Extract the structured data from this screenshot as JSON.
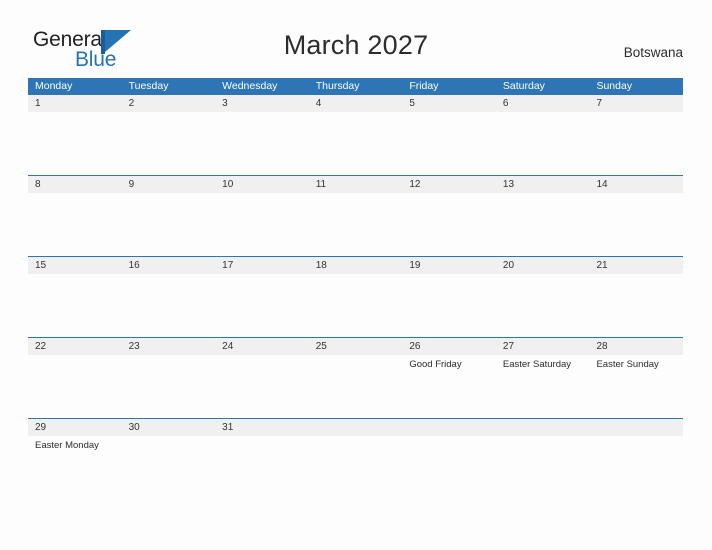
{
  "brand": {
    "name_top": "General",
    "name_bottom": "Blue",
    "accent_color": "#2474b5",
    "logo_mark": "triangle-flag"
  },
  "header": {
    "title": "March 2027",
    "country": "Botswana",
    "header_color": "#2e75b6",
    "band_color": "#f0f0f0"
  },
  "weekdays": [
    "Monday",
    "Tuesday",
    "Wednesday",
    "Thursday",
    "Friday",
    "Saturday",
    "Sunday"
  ],
  "weeks": [
    [
      {
        "day": "1",
        "holiday": ""
      },
      {
        "day": "2",
        "holiday": ""
      },
      {
        "day": "3",
        "holiday": ""
      },
      {
        "day": "4",
        "holiday": ""
      },
      {
        "day": "5",
        "holiday": ""
      },
      {
        "day": "6",
        "holiday": ""
      },
      {
        "day": "7",
        "holiday": ""
      }
    ],
    [
      {
        "day": "8",
        "holiday": ""
      },
      {
        "day": "9",
        "holiday": ""
      },
      {
        "day": "10",
        "holiday": ""
      },
      {
        "day": "11",
        "holiday": ""
      },
      {
        "day": "12",
        "holiday": ""
      },
      {
        "day": "13",
        "holiday": ""
      },
      {
        "day": "14",
        "holiday": ""
      }
    ],
    [
      {
        "day": "15",
        "holiday": ""
      },
      {
        "day": "16",
        "holiday": ""
      },
      {
        "day": "17",
        "holiday": ""
      },
      {
        "day": "18",
        "holiday": ""
      },
      {
        "day": "19",
        "holiday": ""
      },
      {
        "day": "20",
        "holiday": ""
      },
      {
        "day": "21",
        "holiday": ""
      }
    ],
    [
      {
        "day": "22",
        "holiday": ""
      },
      {
        "day": "23",
        "holiday": ""
      },
      {
        "day": "24",
        "holiday": ""
      },
      {
        "day": "25",
        "holiday": ""
      },
      {
        "day": "26",
        "holiday": "Good Friday"
      },
      {
        "day": "27",
        "holiday": "Easter Saturday"
      },
      {
        "day": "28",
        "holiday": "Easter Sunday"
      }
    ],
    [
      {
        "day": "29",
        "holiday": "Easter Monday"
      },
      {
        "day": "30",
        "holiday": ""
      },
      {
        "day": "31",
        "holiday": ""
      },
      {
        "day": "",
        "holiday": ""
      },
      {
        "day": "",
        "holiday": ""
      },
      {
        "day": "",
        "holiday": ""
      },
      {
        "day": "",
        "holiday": ""
      }
    ]
  ]
}
